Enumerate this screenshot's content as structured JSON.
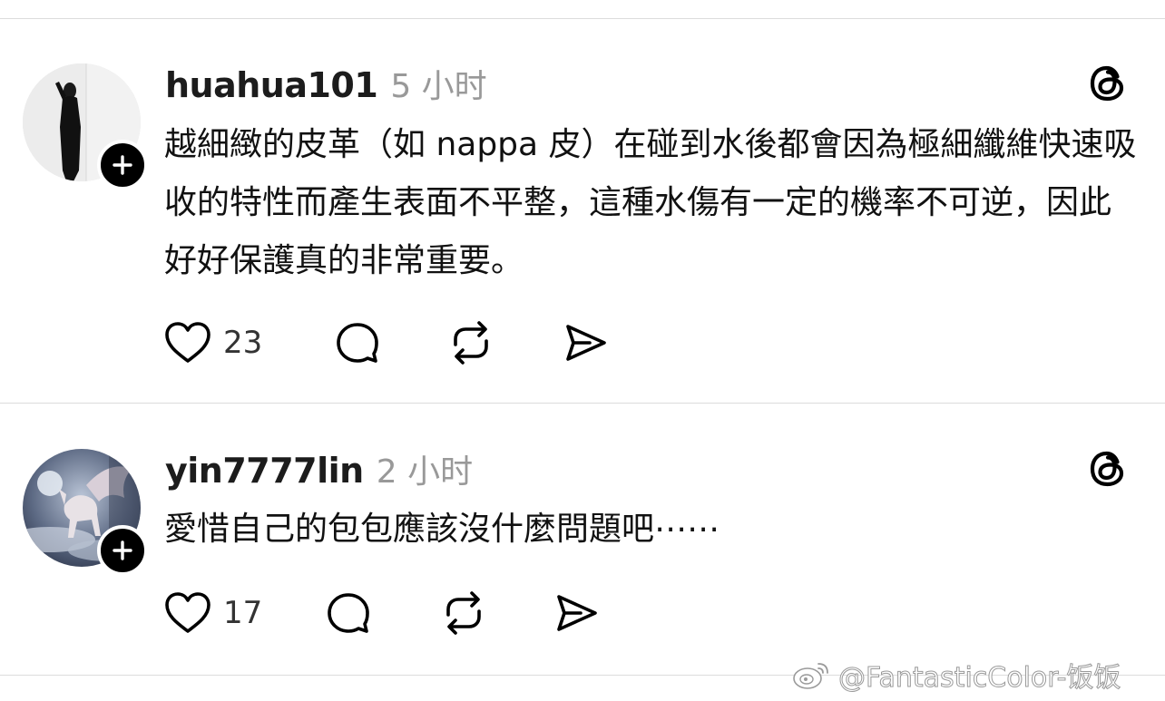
{
  "posts": [
    {
      "username": "huahua101",
      "time": "5 小时",
      "text": "越細緻的皮革（如 nappa 皮）在碰到水後都會因為極細纖維快速吸收的特性而產生表面不平整，這種水傷有一定的機率不可逆，因此好好保護真的非常重要。",
      "like_count": "23",
      "avatar_icon": "person-photo",
      "menu_icon": "threads-logo-icon"
    },
    {
      "username": "yin7777lin",
      "time": "2 小时",
      "text": "愛惜自己的包包應該沒什麼問題吧⋯⋯",
      "like_count": "17",
      "avatar_icon": "pegasus-photo",
      "menu_icon": "threads-logo-icon"
    }
  ],
  "icons": {
    "like": "heart-icon",
    "comment": "comment-bubble-icon",
    "repost": "repost-icon",
    "share": "send-icon",
    "follow": "plus-icon"
  },
  "watermark": {
    "text": "@FantasticColor-饭饭",
    "icon": "weibo-logo-icon"
  },
  "colors": {
    "text": "#111111",
    "secondary": "#999999",
    "divider": "#dcdcdc",
    "badge": "#000000"
  }
}
